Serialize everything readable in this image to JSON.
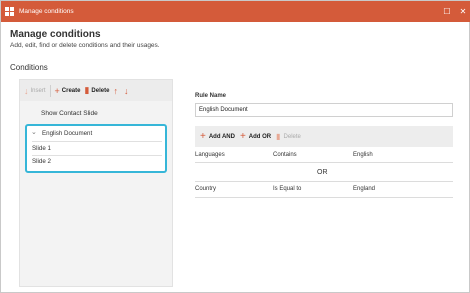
{
  "window": {
    "title": "Manage conditions",
    "restore_glyph": "☐",
    "close_glyph": "✕"
  },
  "header": {
    "title": "Manage conditions",
    "subtitle": "Add, edit, find or delete conditions and their usages."
  },
  "conditions": {
    "title": "Conditions",
    "toolbar": {
      "insert": "Insert",
      "create": "Create",
      "delete": "Delete",
      "up_glyph": "↑",
      "down_glyph": "↓"
    },
    "items": [
      {
        "label": "Show Contact Slide"
      }
    ],
    "group": {
      "label": "English Document",
      "chevron": "⌄",
      "children": [
        "Slide 1",
        "Slide 2"
      ]
    }
  },
  "rule": {
    "name_label": "Rule Name",
    "name_value": "English Document",
    "toolbar": {
      "add_and": "Add AND",
      "add_or": "Add OR",
      "delete": "Delete"
    },
    "rows": [
      {
        "field": "Languages",
        "operator": "Contains",
        "value": "English"
      },
      {
        "field": "Country",
        "operator": "Is Equal to",
        "value": "England"
      }
    ],
    "or_label": "OR"
  },
  "colors": {
    "accent": "#d45b3a",
    "highlight": "#36b6d8"
  }
}
